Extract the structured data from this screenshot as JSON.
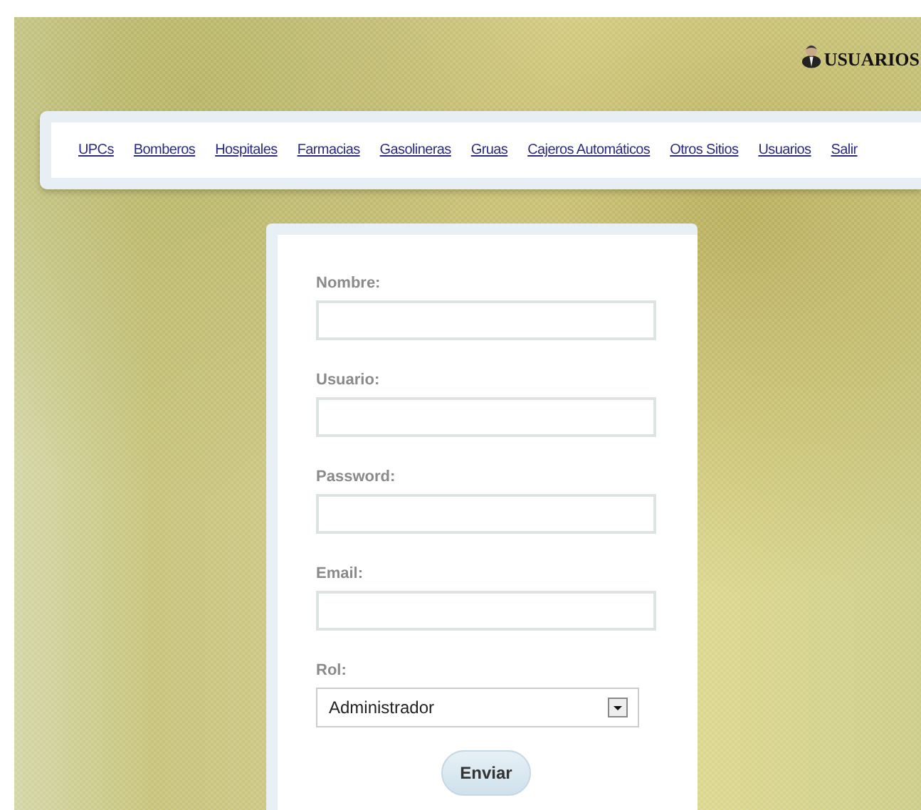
{
  "header": {
    "title": "USUARIOS"
  },
  "nav": [
    {
      "label": "UPCs"
    },
    {
      "label": "Bomberos"
    },
    {
      "label": "Hospitales"
    },
    {
      "label": "Farmacias"
    },
    {
      "label": "Gasolineras"
    },
    {
      "label": "Gruas"
    },
    {
      "label": "Cajeros Automáticos"
    },
    {
      "label": "Otros Sitios"
    },
    {
      "label": "Usuarios"
    },
    {
      "label": "Salir"
    }
  ],
  "form": {
    "fields": [
      {
        "kind": "text",
        "label": "Nombre:"
      },
      {
        "kind": "text",
        "label": "Usuario:"
      },
      {
        "kind": "text",
        "label": "Password:"
      },
      {
        "kind": "text",
        "label": "Email:"
      },
      {
        "kind": "select",
        "label": "Rol:",
        "value": "Administrador"
      }
    ],
    "submit": "Enviar"
  }
}
